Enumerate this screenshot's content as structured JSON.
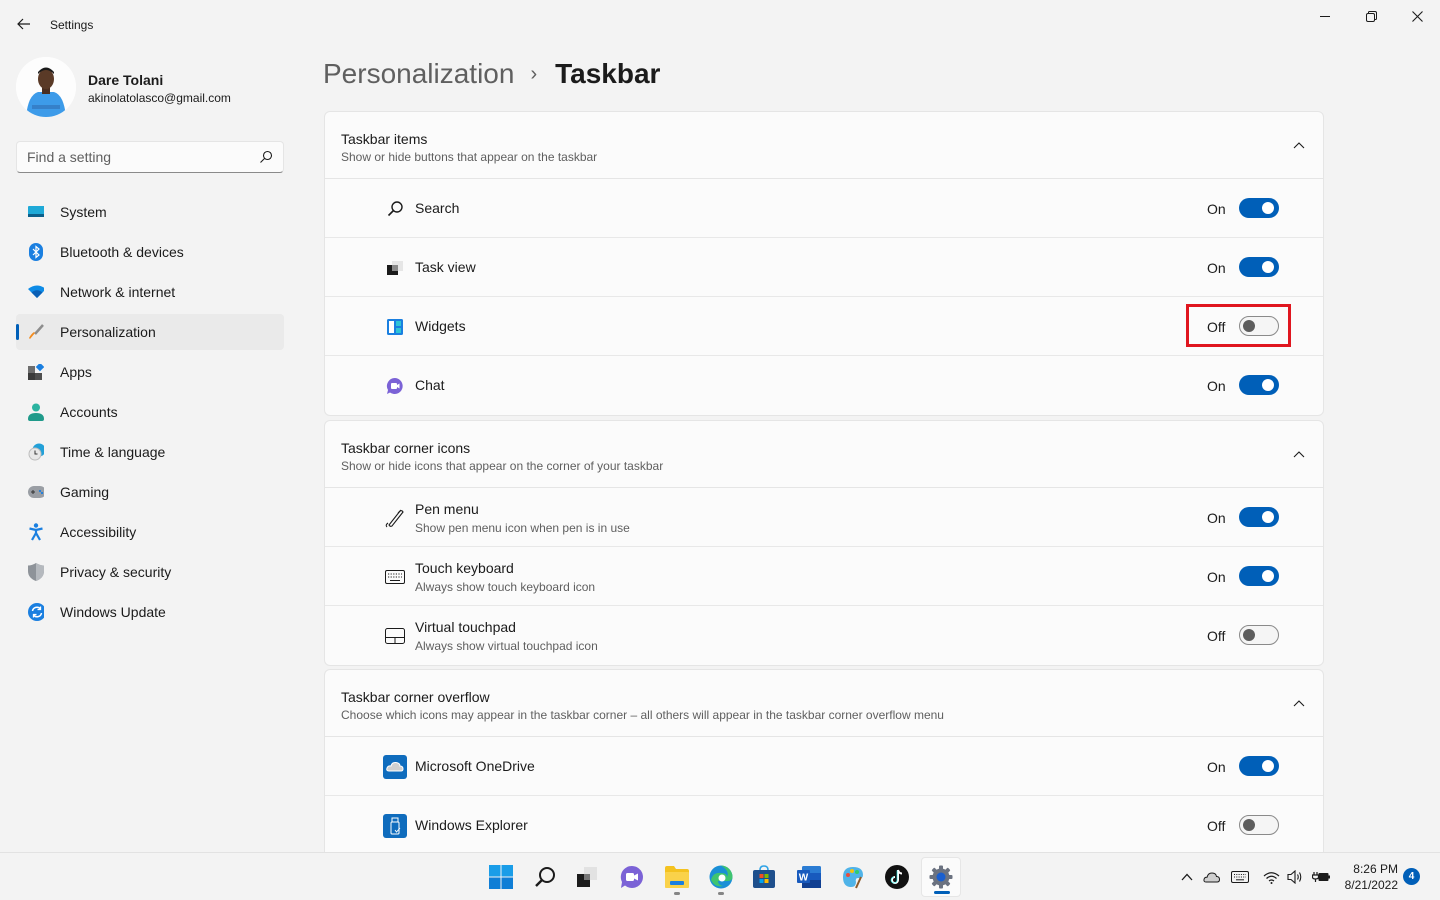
{
  "window": {
    "title": "Settings",
    "controls": [
      "minimize",
      "maximize",
      "close"
    ]
  },
  "profile": {
    "name": "Dare Tolani",
    "email": "akinolatolasco@gmail.com"
  },
  "search": {
    "placeholder": "Find a setting",
    "value": ""
  },
  "sidebar": {
    "active": "Personalization",
    "items": [
      {
        "label": "System",
        "icon": "monitor-icon"
      },
      {
        "label": "Bluetooth & devices",
        "icon": "bluetooth-icon"
      },
      {
        "label": "Network & internet",
        "icon": "wifi-icon"
      },
      {
        "label": "Personalization",
        "icon": "paintbrush-icon"
      },
      {
        "label": "Apps",
        "icon": "apps-icon"
      },
      {
        "label": "Accounts",
        "icon": "person-icon"
      },
      {
        "label": "Time & language",
        "icon": "clock-globe-icon"
      },
      {
        "label": "Gaming",
        "icon": "gamepad-icon"
      },
      {
        "label": "Accessibility",
        "icon": "accessibility-icon"
      },
      {
        "label": "Privacy & security",
        "icon": "shield-icon"
      },
      {
        "label": "Windows Update",
        "icon": "update-icon"
      }
    ]
  },
  "breadcrumb": {
    "parent": "Personalization",
    "separator": "›",
    "current": "Taskbar"
  },
  "sections": [
    {
      "title": "Taskbar items",
      "subtitle": "Show or hide buttons that appear on the taskbar",
      "expanded": true,
      "rows": [
        {
          "title": "Search",
          "subtitle": "",
          "icon": "search-icon",
          "state": "On"
        },
        {
          "title": "Task view",
          "subtitle": "",
          "icon": "task-view-icon",
          "state": "On"
        },
        {
          "title": "Widgets",
          "subtitle": "",
          "icon": "widgets-icon",
          "state": "Off",
          "highlighted": true
        },
        {
          "title": "Chat",
          "subtitle": "",
          "icon": "chat-icon",
          "state": "On"
        }
      ]
    },
    {
      "title": "Taskbar corner icons",
      "subtitle": "Show or hide icons that appear on the corner of your taskbar",
      "expanded": true,
      "rows": [
        {
          "title": "Pen menu",
          "subtitle": "Show pen menu icon when pen is in use",
          "icon": "pen-icon",
          "state": "On"
        },
        {
          "title": "Touch keyboard",
          "subtitle": "Always show touch keyboard icon",
          "icon": "keyboard-icon",
          "state": "On"
        },
        {
          "title": "Virtual touchpad",
          "subtitle": "Always show virtual touchpad icon",
          "icon": "touchpad-icon",
          "state": "Off"
        }
      ]
    },
    {
      "title": "Taskbar corner overflow",
      "subtitle": "Choose which icons may appear in the taskbar corner – all others will appear in the taskbar corner overflow menu",
      "expanded": true,
      "rows": [
        {
          "title": "Microsoft OneDrive",
          "subtitle": "",
          "icon": "onedrive-icon",
          "state": "On"
        },
        {
          "title": "Windows Explorer",
          "subtitle": "",
          "icon": "usb-drive-icon",
          "state": "Off"
        }
      ]
    }
  ],
  "taskbar": {
    "apps": [
      {
        "name": "start",
        "running": false
      },
      {
        "name": "search",
        "running": false
      },
      {
        "name": "task-view",
        "running": false
      },
      {
        "name": "chat",
        "running": false
      },
      {
        "name": "file-explorer",
        "running": true
      },
      {
        "name": "edge",
        "running": true
      },
      {
        "name": "microsoft-store",
        "running": false
      },
      {
        "name": "word",
        "running": false
      },
      {
        "name": "paint",
        "running": false
      },
      {
        "name": "tiktok",
        "running": false
      },
      {
        "name": "settings",
        "running": true,
        "active": true
      }
    ],
    "tray": {
      "time": "8:26 PM",
      "date": "8/21/2022",
      "notification_count": "4"
    }
  },
  "colors": {
    "accent": "#005fb8",
    "highlight_box": "#e0161f"
  }
}
